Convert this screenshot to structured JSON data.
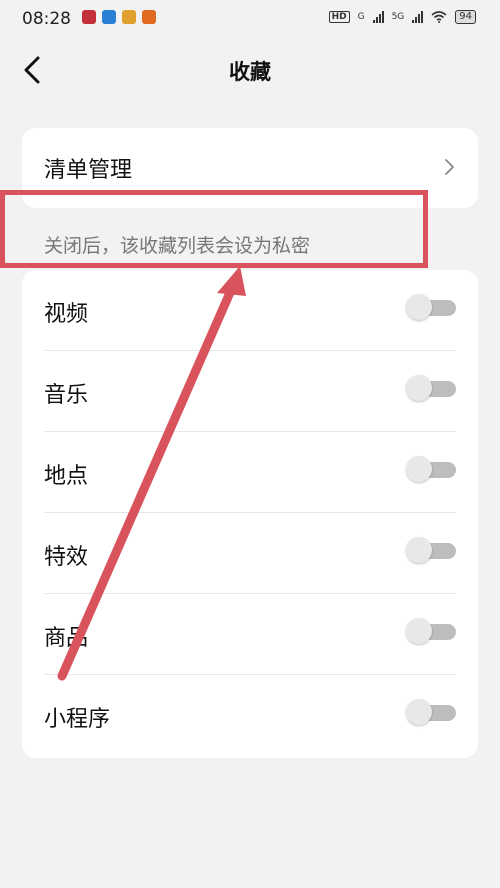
{
  "status_bar": {
    "time": "08:28",
    "hd_label": "HD",
    "network_label_1": "G",
    "network_label_2": "5G",
    "battery": "94"
  },
  "header": {
    "title": "收藏"
  },
  "manage": {
    "label": "清单管理"
  },
  "hint": "关闭后，该收藏列表会设为私密",
  "list": {
    "items": [
      {
        "label": "视频",
        "enabled": false
      },
      {
        "label": "音乐",
        "enabled": false
      },
      {
        "label": "地点",
        "enabled": false
      },
      {
        "label": "特效",
        "enabled": false
      },
      {
        "label": "商品",
        "enabled": false
      },
      {
        "label": "小程序",
        "enabled": false
      }
    ]
  },
  "colors": {
    "background": "#f2f2f2",
    "card": "#ffffff",
    "annotation": "#d9535c",
    "toggle_track_off": "#bdbdbd"
  },
  "icons": {
    "back": "chevron-left-icon",
    "manage": "chevron-right-icon"
  }
}
